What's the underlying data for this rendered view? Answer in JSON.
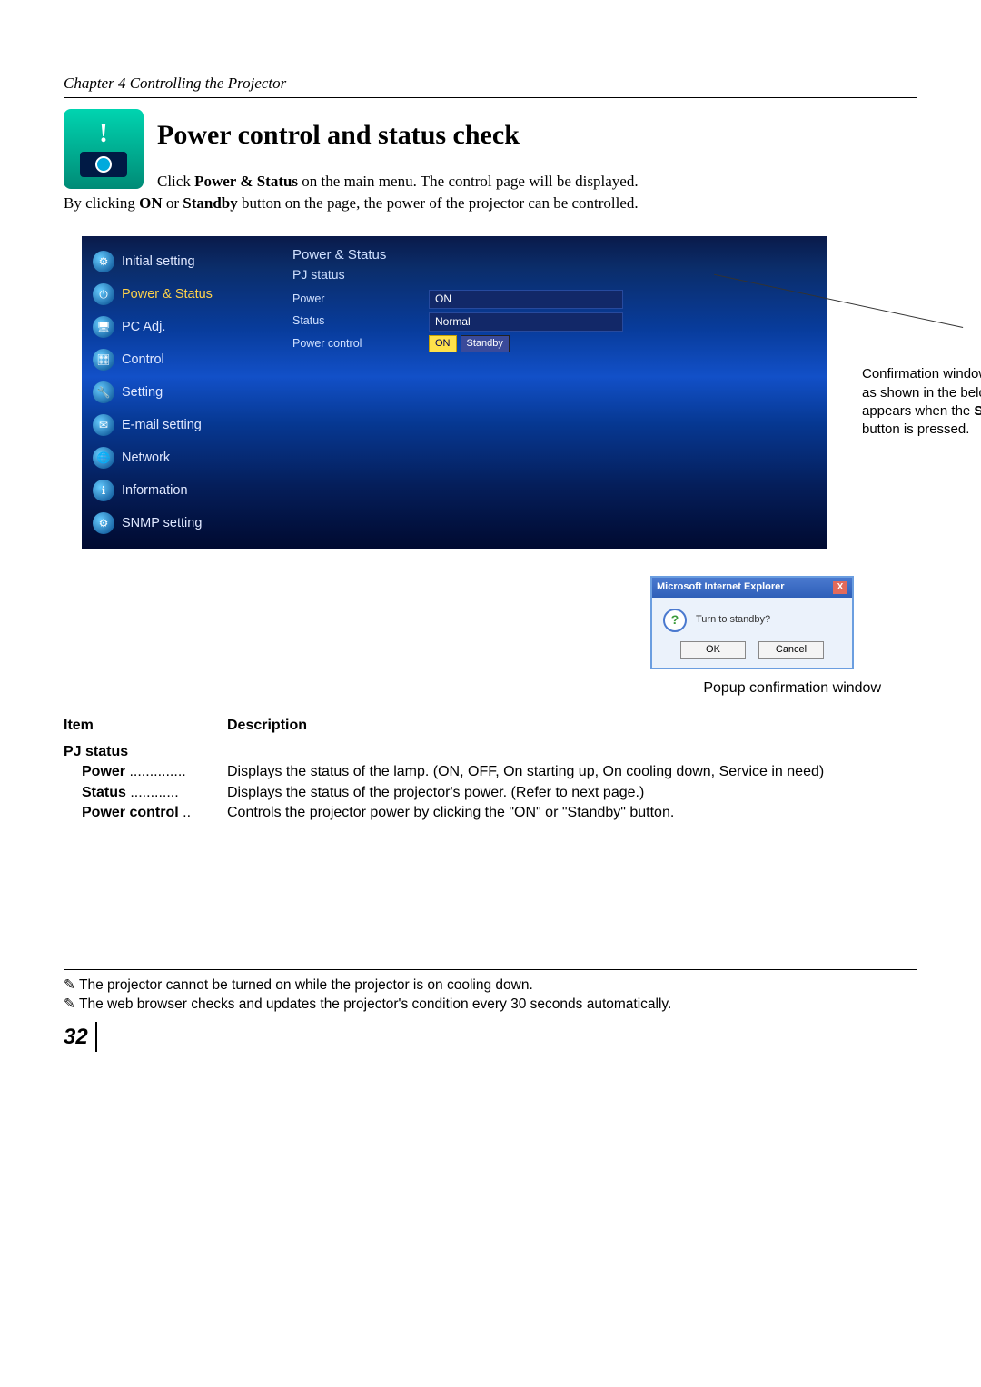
{
  "chapter": "Chapter 4 Controlling the Projector",
  "title": "Power control and status check",
  "intro_part1": "Click ",
  "intro_bold1": "Power & Status",
  "intro_part2": " on the main menu. The control page will be displayed.",
  "intro2_a": "By clicking ",
  "intro2_on": "ON",
  "intro2_b": " or ",
  "intro2_standby": "Standby",
  "intro2_c": " button on the page, the power of the projector can be controlled.",
  "sidebar": {
    "items": [
      "Initial setting",
      "Power & Status",
      "PC Adj.",
      "Control",
      "Setting",
      "E-mail setting",
      "Network",
      "Information",
      "SNMP setting"
    ]
  },
  "panel": {
    "title": "Power & Status",
    "section": "PJ status",
    "power_label": "Power",
    "power_value": "ON",
    "status_label": "Status",
    "status_value": "Normal",
    "pc_label": "Power control",
    "btn_on": "ON",
    "btn_standby": "Standby"
  },
  "callout": {
    "l1": "Confirmation window",
    "l2": "as shown in the below",
    "l3a": "appears  when the ",
    "l3b": "Standby",
    "l4": "button is pressed."
  },
  "popup": {
    "title": "Microsoft Internet Explorer",
    "message": "Turn to standby?",
    "ok": "OK",
    "cancel": "Cancel",
    "caption": "Popup confirmation window"
  },
  "table": {
    "col1": "Item",
    "col2": "Description",
    "section": "PJ status",
    "rows": [
      {
        "item": "Power",
        "desc": "Displays the status of the lamp. (ON, OFF, On starting up, On cooling down, Service in need)"
      },
      {
        "item": "Status",
        "desc": "Displays the status of the projector's power. (Refer to next page.)"
      },
      {
        "item": "Power control",
        "desc": "Controls the projector power by clicking the \"ON\" or \"Standby\" button."
      }
    ]
  },
  "notes": [
    "The projector cannot be turned on while the projector is on cooling down.",
    "The web browser checks and updates the projector's condition every 30 seconds automatically."
  ],
  "page": "32"
}
